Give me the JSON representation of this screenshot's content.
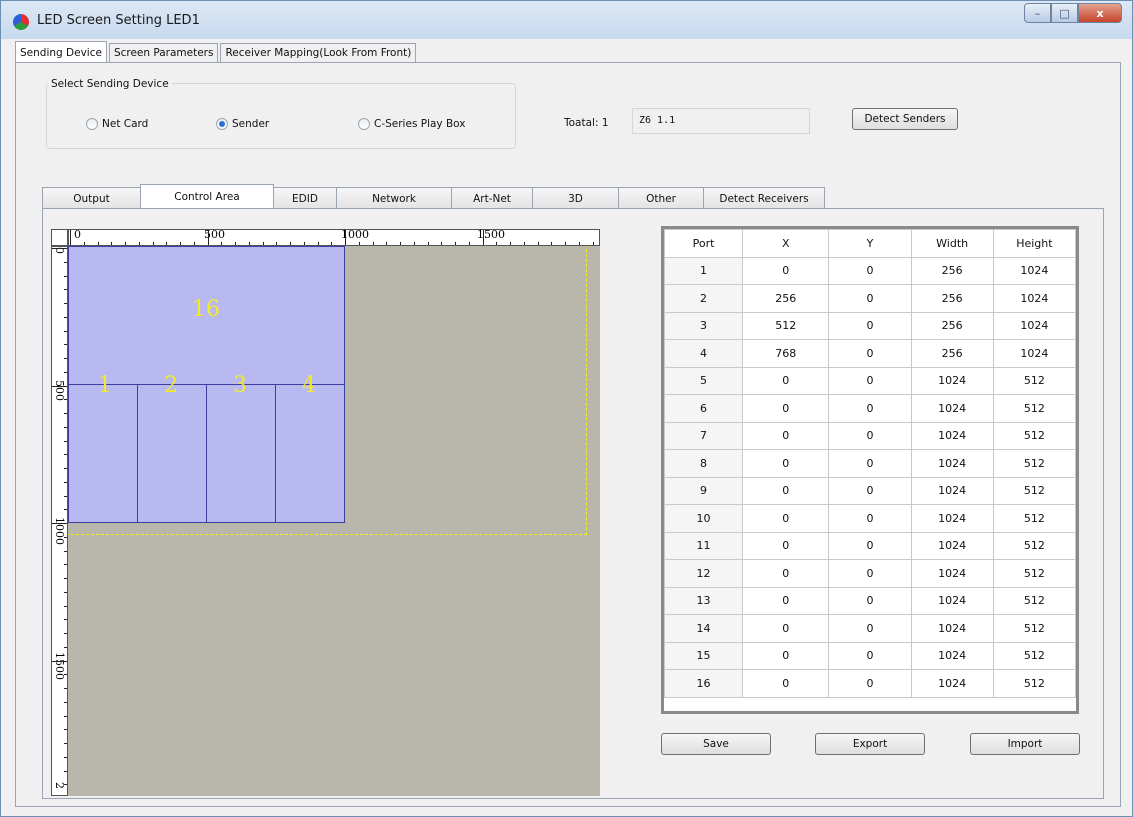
{
  "window": {
    "title": "LED Screen Setting LED1",
    "controls": {
      "minimize": "–",
      "maximize": "□",
      "close": "x"
    }
  },
  "top_tabs": [
    "Sending Device",
    "Screen Parameters",
    "Receiver Mapping(Look From Front)"
  ],
  "device_group": {
    "title": "Select Sending Device",
    "options": [
      "Net Card",
      "Sender",
      "C-Series Play Box"
    ],
    "selected": "Sender"
  },
  "total": {
    "label": "Toatal: 1",
    "value": "Z6 1.1"
  },
  "detect_senders_label": "Detect Senders",
  "inner_tabs": [
    "Output",
    "Control Area",
    "EDID",
    "Network",
    "Art-Net",
    "3D",
    "Other",
    "Detect Receivers"
  ],
  "active_inner_tab": "Control Area",
  "ruler": {
    "h_labels": [
      "0",
      "500",
      "1000",
      "1500"
    ],
    "v_labels": [
      "0",
      "500",
      "1000",
      "1500",
      "2"
    ]
  },
  "canvas_regions": {
    "large": "16",
    "small": [
      "1",
      "2",
      "3",
      "4"
    ]
  },
  "table": {
    "headers": [
      "Port",
      "X",
      "Y",
      "Width",
      "Height"
    ],
    "rows": [
      [
        "1",
        "0",
        "0",
        "256",
        "1024"
      ],
      [
        "2",
        "256",
        "0",
        "256",
        "1024"
      ],
      [
        "3",
        "512",
        "0",
        "256",
        "1024"
      ],
      [
        "4",
        "768",
        "0",
        "256",
        "1024"
      ],
      [
        "5",
        "0",
        "0",
        "1024",
        "512"
      ],
      [
        "6",
        "0",
        "0",
        "1024",
        "512"
      ],
      [
        "7",
        "0",
        "0",
        "1024",
        "512"
      ],
      [
        "8",
        "0",
        "0",
        "1024",
        "512"
      ],
      [
        "9",
        "0",
        "0",
        "1024",
        "512"
      ],
      [
        "10",
        "0",
        "0",
        "1024",
        "512"
      ],
      [
        "11",
        "0",
        "0",
        "1024",
        "512"
      ],
      [
        "12",
        "0",
        "0",
        "1024",
        "512"
      ],
      [
        "13",
        "0",
        "0",
        "1024",
        "512"
      ],
      [
        "14",
        "0",
        "0",
        "1024",
        "512"
      ],
      [
        "15",
        "0",
        "0",
        "1024",
        "512"
      ],
      [
        "16",
        "0",
        "0",
        "1024",
        "512"
      ]
    ]
  },
  "buttons": {
    "save": "Save",
    "export": "Export",
    "import": "Import"
  },
  "colors": {
    "region_fill": "#b9b9f2",
    "region_label": "#f3ea29",
    "canvas_bg": "#b9b7ab",
    "dash_outline": "#f5ec1a"
  }
}
